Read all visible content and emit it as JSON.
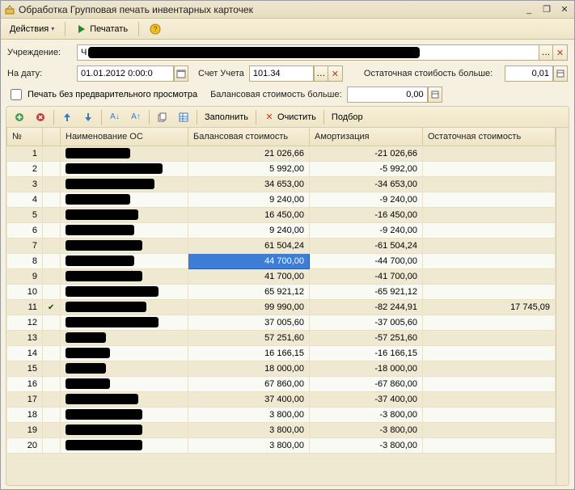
{
  "window": {
    "title": "Обработка  Групповая печать инвентарных карточек",
    "minimize": "_",
    "restore": "❐",
    "close": "✕"
  },
  "toolbar": {
    "actions": "Действия",
    "print": "Печатать",
    "help": "?"
  },
  "form": {
    "uchr_label": "Учреждение:",
    "uchr_value": "Ч",
    "date_label": "На дату:",
    "date_value": "01.01.2012 0:00:0",
    "schet_label": "Счет Учета",
    "schet_value": "101.34",
    "ost_label": "Остаточная стоибость больше:",
    "ost_value": "0,01",
    "preview_label": "Печать без предварительного просмотра",
    "bal_label": "Балансовая стоимость больше:",
    "bal_value": "0,00"
  },
  "panel_tb": {
    "fill": "Заполнить",
    "clear": "Очистить",
    "select": "Подбор"
  },
  "grid": {
    "headers": {
      "num": "№",
      "name": "Наименование ОС",
      "bal": "Балансовая стоимость",
      "amort": "Амортизация",
      "ost": "Остаточная стоимость"
    },
    "rows": [
      {
        "n": "1",
        "bal": "21 026,66",
        "amort": "-21 026,66",
        "ost": "",
        "rw": 80,
        "chk": false
      },
      {
        "n": "2",
        "bal": "5 992,00",
        "amort": "-5 992,00",
        "ost": "",
        "rw": 120,
        "chk": false
      },
      {
        "n": "3",
        "bal": "34 653,00",
        "amort": "-34 653,00",
        "ost": "",
        "rw": 110,
        "chk": false
      },
      {
        "n": "4",
        "bal": "9 240,00",
        "amort": "-9 240,00",
        "ost": "",
        "rw": 80,
        "chk": false
      },
      {
        "n": "5",
        "bal": "16 450,00",
        "amort": "-16 450,00",
        "ost": "",
        "rw": 90,
        "chk": false
      },
      {
        "n": "6",
        "bal": "9 240,00",
        "amort": "-9 240,00",
        "ost": "",
        "rw": 85,
        "chk": false
      },
      {
        "n": "7",
        "bal": "61 504,24",
        "amort": "-61 504,24",
        "ost": "",
        "rw": 95,
        "chk": false
      },
      {
        "n": "8",
        "bal": "44 700,00",
        "amort": "-44 700,00",
        "ost": "",
        "rw": 85,
        "chk": false,
        "sel": true
      },
      {
        "n": "9",
        "bal": "41 700,00",
        "amort": "-41 700,00",
        "ost": "",
        "rw": 95,
        "chk": false
      },
      {
        "n": "10",
        "bal": "65 921,12",
        "amort": "-65 921,12",
        "ost": "",
        "rw": 115,
        "chk": false
      },
      {
        "n": "11",
        "bal": "99 990,00",
        "amort": "-82 244,91",
        "ost": "17 745,09",
        "rw": 100,
        "chk": true
      },
      {
        "n": "12",
        "bal": "37 005,60",
        "amort": "-37 005,60",
        "ost": "",
        "rw": 115,
        "chk": false
      },
      {
        "n": "13",
        "bal": "57 251,60",
        "amort": "-57 251,60",
        "ost": "",
        "rw": 50,
        "chk": false
      },
      {
        "n": "14",
        "bal": "16 166,15",
        "amort": "-16 166,15",
        "ost": "",
        "rw": 55,
        "chk": false
      },
      {
        "n": "15",
        "bal": "18 000,00",
        "amort": "-18 000,00",
        "ost": "",
        "rw": 50,
        "chk": false
      },
      {
        "n": "16",
        "bal": "67 860,00",
        "amort": "-67 860,00",
        "ost": "",
        "rw": 55,
        "chk": false
      },
      {
        "n": "17",
        "bal": "37 400,00",
        "amort": "-37 400,00",
        "ost": "",
        "rw": 90,
        "chk": false
      },
      {
        "n": "18",
        "bal": "3 800,00",
        "amort": "-3 800,00",
        "ost": "",
        "rw": 95,
        "chk": false
      },
      {
        "n": "19",
        "bal": "3 800,00",
        "amort": "-3 800,00",
        "ost": "",
        "rw": 95,
        "chk": false
      },
      {
        "n": "20",
        "bal": "3 800,00",
        "amort": "-3 800,00",
        "ost": "",
        "rw": 95,
        "chk": false
      }
    ]
  }
}
